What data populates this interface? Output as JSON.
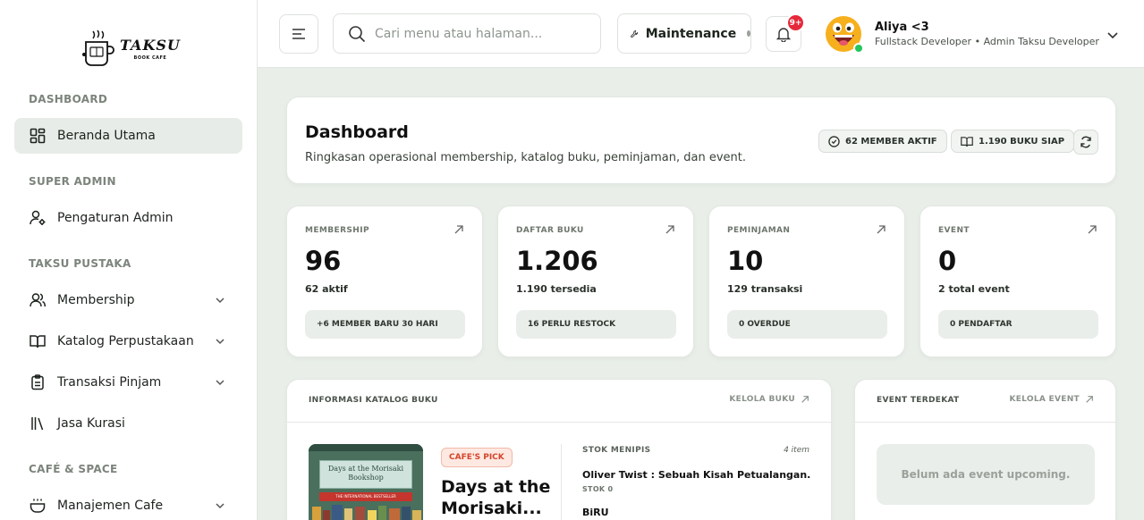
{
  "brand": {
    "name": "TAKSU",
    "tagline": "BOOK CAFE"
  },
  "sidebar": {
    "sections": [
      {
        "title": "DASHBOARD"
      },
      {
        "title": "SUPER ADMIN"
      },
      {
        "title": "TAKSU PUSTAKA"
      },
      {
        "title": "CAFÉ & SPACE"
      }
    ],
    "items": [
      {
        "label": "Beranda Utama",
        "icon": "dashboard-icon",
        "active": true
      },
      {
        "label": "Pengaturan Admin",
        "icon": "user-gear-icon"
      },
      {
        "label": "Membership",
        "icon": "users-icon",
        "expandable": true
      },
      {
        "label": "Katalog Perpustakaan",
        "icon": "book-open-icon",
        "expandable": true
      },
      {
        "label": "Transaksi Pinjam",
        "icon": "clipboard-icon",
        "expandable": true
      },
      {
        "label": "Jasa Kurasi",
        "icon": "library-icon"
      },
      {
        "label": "Manajemen Cafe",
        "icon": "coffee-cup-icon",
        "expandable": true
      }
    ]
  },
  "topbar": {
    "search_placeholder": "Cari menu atau halaman...",
    "maintenance_label": "Maintenance",
    "notification_badge": "9+",
    "user": {
      "name": "Aliya <3",
      "role": "Fullstack Developer • Admin Taksu Developer"
    }
  },
  "dashboard": {
    "title": "Dashboard",
    "subtitle": "Ringkasan operasional membership, katalog buku, peminjaman, dan event.",
    "pills": {
      "members": "62 MEMBER AKTIF",
      "books": "1.190 BUKU SIAP"
    }
  },
  "stats": [
    {
      "label": "MEMBERSHIP",
      "value": "96",
      "sub": "62 aktif",
      "foot": "+6 MEMBER BARU 30 HARI"
    },
    {
      "label": "DAFTAR BUKU",
      "value": "1.206",
      "sub": "1.190 tersedia",
      "foot": "16 PERLU RESTOCK"
    },
    {
      "label": "PEMINJAMAN",
      "value": "10",
      "sub": "129 transaksi",
      "foot": "0 OVERDUE"
    },
    {
      "label": "EVENT",
      "value": "0",
      "sub": "2 total event",
      "foot": "0 PENDAFTAR"
    }
  ],
  "katalog": {
    "title": "INFORMASI KATALOG BUKU",
    "link": "KELOLA BUKU",
    "featured": {
      "badge": "CAFE'S PICK",
      "title": "Days at the Morisaki...",
      "cover_title": "Days at the Morisaki Bookshop",
      "cover_band": "THE INTERNATIONAL BESTSELLER"
    },
    "stok": {
      "title": "STOK MENIPIS",
      "count": "4 item",
      "items": [
        {
          "title": "Oliver Twist : Sebuah Kisah Petualangan. Ke...",
          "sub": "STOK 0"
        },
        {
          "title": "BiRU",
          "sub": ""
        }
      ]
    }
  },
  "event": {
    "title": "EVENT TERDEKAT",
    "link": "KELOLA EVENT",
    "empty": "Belum ada event upcoming."
  },
  "colors": {
    "page_bg": "#e9eee9",
    "active_bg": "#e8ece8",
    "badge_red": "#e5293b",
    "online_green": "#22c55e",
    "cafe_pick": "#d4452b"
  }
}
